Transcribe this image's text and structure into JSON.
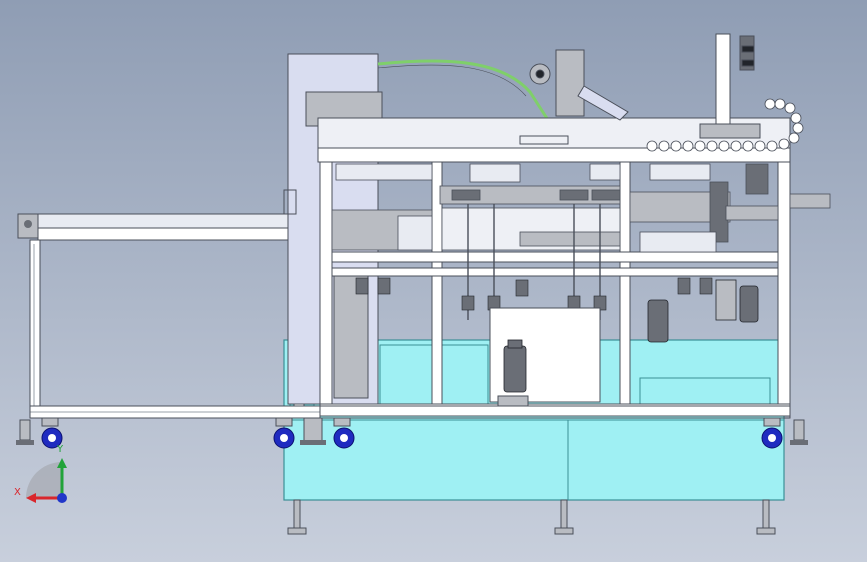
{
  "viewport": {
    "background_top": "#8f9db4",
    "background_bottom": "#c8cfdc"
  },
  "colors": {
    "frame": "#ffffff",
    "frame_edge": "#4a4f5a",
    "steel": "#b9bcc2",
    "steel_dark": "#6a6e76",
    "cabinet": "#9ff0f3",
    "cabinet_edge": "#3b8f96",
    "cover": "#d9ddf0",
    "wheel": "#1f2bc0",
    "hose": "#7fcf6a",
    "dark": "#22252b"
  },
  "triad": {
    "x_label": "X",
    "y_label": "Y",
    "x_color": "#d9262c",
    "y_color": "#21a33a",
    "z_color": "#2036c9"
  }
}
